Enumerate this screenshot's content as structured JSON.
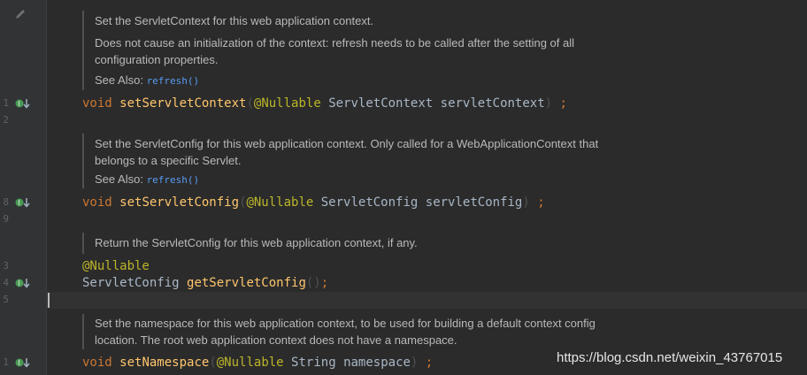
{
  "gutter": {
    "line_numbers": [
      "1",
      "2",
      "8",
      "9",
      "3",
      "4",
      "5",
      "1"
    ]
  },
  "blocks": [
    {
      "doc_lines": [
        "Set the ServletContext for this web application context.",
        "Does not cause an initialization of the context: refresh needs to be called after the setting of all configuration properties."
      ],
      "see_also_label": "See Also:",
      "see_also_link": "refresh()",
      "code": {
        "keyword": "void",
        "method": "setServletContext",
        "open": "(",
        "annotation": "@Nullable",
        "param_type": "ServletContext",
        "param_name": "servletContext",
        "close": ")",
        "semicolon": ";"
      }
    },
    {
      "doc_lines": [
        "Set the ServletConfig for this web application context. Only called for a WebApplicationContext that belongs to a specific Servlet."
      ],
      "see_also_label": "See Also:",
      "see_also_link": "refresh()",
      "code": {
        "keyword": "void",
        "method": "setServletConfig",
        "open": "(",
        "annotation": "@Nullable",
        "param_type": "ServletConfig",
        "param_name": "servletConfig",
        "close": ")",
        "semicolon": ";"
      }
    },
    {
      "doc_lines": [
        "Return the ServletConfig for this web application context, if any."
      ],
      "code": {
        "annotation": "@Nullable",
        "return_type": "ServletConfig",
        "method": "getServletConfig",
        "parens": "()",
        "semicolon": ";"
      }
    },
    {
      "doc_lines": [
        "Set the namespace for this web application context, to be used for building a default context config location. The root web application context does not have a namespace."
      ],
      "code": {
        "keyword": "void",
        "method": "setNamespace",
        "open": "(",
        "annotation": "@Nullable",
        "param_type": "String",
        "param_name": "namespace",
        "close": ")",
        "semicolon": ";"
      }
    }
  ],
  "watermark": "https://blog.csdn.net/weixin_43767015",
  "colors": {
    "background": "#2b2b2b",
    "gutter": "#313335",
    "keyword": "#cc7832",
    "annotation": "#bbb529",
    "link": "#589df6",
    "implemented_marker": "#499c54"
  }
}
